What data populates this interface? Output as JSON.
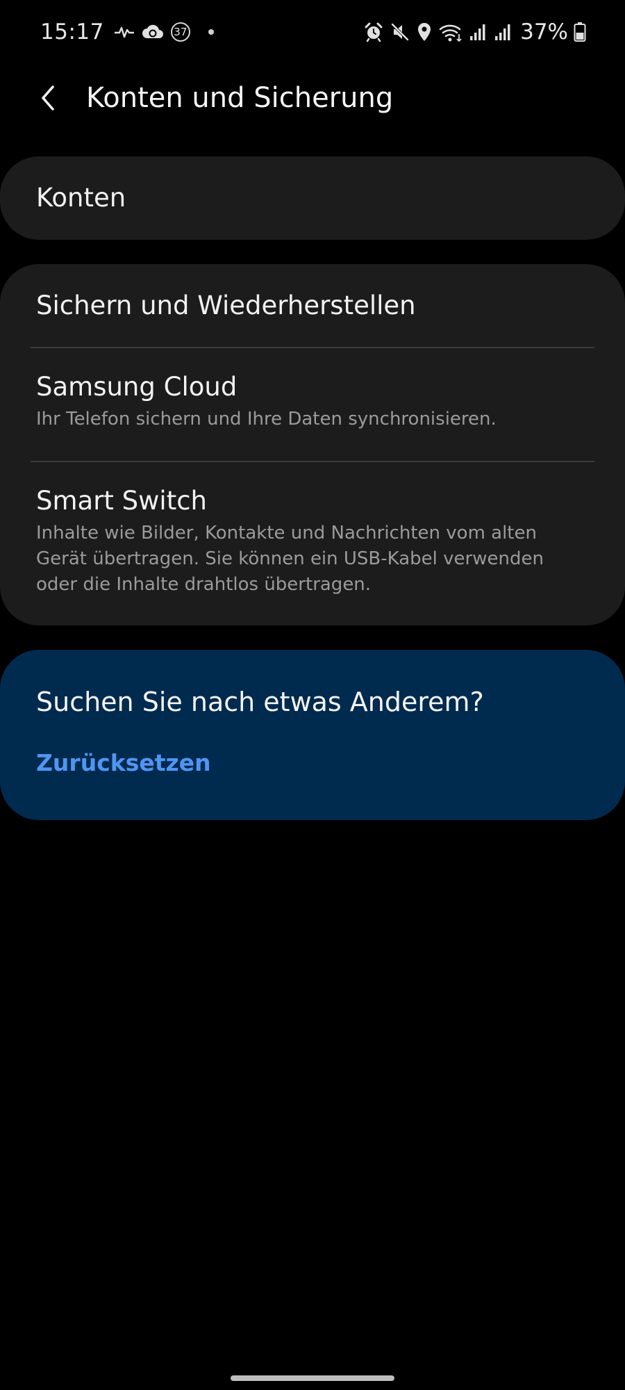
{
  "status_bar": {
    "time": "15:17",
    "notification_badge": "37",
    "battery_percent": "37%",
    "icons_left": [
      "pulse-icon",
      "cloud-sync-icon",
      "badge-icon",
      "dot-icon"
    ],
    "icons_right": [
      "alarm-icon",
      "mute-icon",
      "location-icon",
      "wifi-icon",
      "signal-icon",
      "signal-icon",
      "battery-icon"
    ]
  },
  "header": {
    "title": "Konten und Sicherung",
    "back_icon": "back-arrow-icon"
  },
  "sections": {
    "accounts": {
      "title": "Konten"
    },
    "backup": {
      "items": [
        {
          "title": "Sichern und Wiederherstellen",
          "subtitle": ""
        },
        {
          "title": "Samsung Cloud",
          "subtitle": "Ihr Telefon sichern und Ihre Daten synchronisieren."
        },
        {
          "title": "Smart Switch",
          "subtitle": "Inhalte wie Bilder, Kontakte und Nachrichten vom alten Gerät übertragen. Sie können ein USB-Kabel verwenden oder die Inhalte drahtlos übertragen."
        }
      ]
    }
  },
  "suggestion": {
    "title": "Suchen Sie nach etwas Anderem?",
    "link": "Zurücksetzen"
  },
  "colors": {
    "background": "#000000",
    "card": "#1c1c1c",
    "suggestion_card": "#012a4f",
    "link": "#4f96f2",
    "subtitle": "#9b9b9b"
  }
}
